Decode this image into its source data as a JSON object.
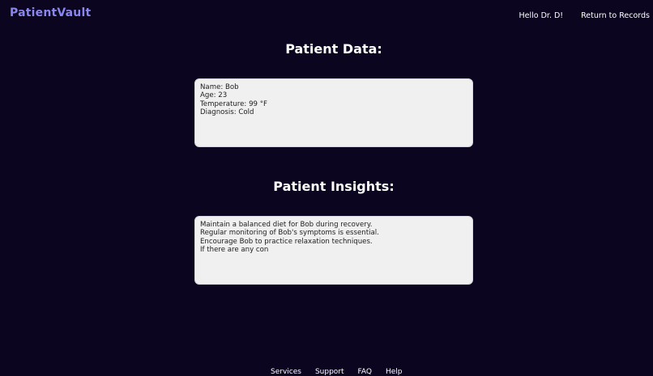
{
  "app": {
    "brand": "PatientVault"
  },
  "nav": {
    "greeting": "Hello Dr. D!",
    "return_link": "Return to Records"
  },
  "patient_data": {
    "title": "Patient Data:",
    "lines": [
      "Name: Bob",
      "Age: 23",
      "Temperature: 99 °F",
      "Diagnosis: Cold"
    ]
  },
  "patient_insights": {
    "title": "Patient Insights:",
    "lines": [
      "Maintain a balanced diet for Bob during recovery.",
      "Regular monitoring of Bob's symptoms is essential.",
      "Encourage Bob to practice relaxation techniques.",
      "If there are any con"
    ]
  },
  "footer": {
    "links": [
      "Services",
      "Support",
      "FAQ",
      "Help"
    ]
  },
  "colors": {
    "background": "#0b0520",
    "brand": "#8a86f0",
    "card": "#f0f0f0"
  }
}
